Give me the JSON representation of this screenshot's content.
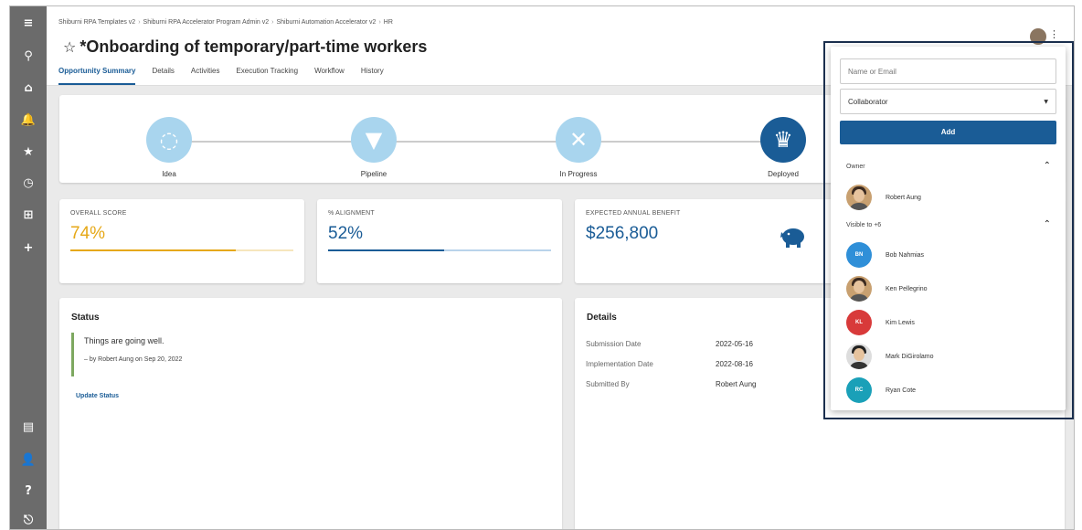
{
  "breadcrumb": [
    "Shiburni RPA Templates v2",
    "Shiburni RPA Accelerator Program Admin v2",
    "Shiburni Automation Accelerator v2",
    "HR"
  ],
  "page": {
    "star": "☆",
    "title": "*Onboarding of temporary/part-time workers"
  },
  "tabs": [
    {
      "label": "Opportunity Summary",
      "active": true
    },
    {
      "label": "Details"
    },
    {
      "label": "Activities"
    },
    {
      "label": "Execution Tracking"
    },
    {
      "label": "Workflow"
    },
    {
      "label": "History"
    }
  ],
  "stages": [
    {
      "label": "Idea",
      "icon": "lightbulb-icon",
      "glyph": "💡"
    },
    {
      "label": "Pipeline",
      "icon": "funnel-icon",
      "glyph": "⏷"
    },
    {
      "label": "In Progress",
      "icon": "tools-icon",
      "glyph": "✖"
    },
    {
      "label": "Deployed",
      "icon": "trophy-icon",
      "glyph": "🏆"
    }
  ],
  "scores": {
    "overall": {
      "label": "OVERALL SCORE",
      "value": "74%",
      "color": "#e6a817"
    },
    "alignment": {
      "label": "% ALIGNMENT",
      "value": "52%",
      "color": "#1a5c96"
    },
    "benefit": {
      "label": "EXPECTED ANNUAL BENEFIT",
      "value": "$256,800",
      "icon": "piggy-bank-icon"
    }
  },
  "status": {
    "heading": "Status",
    "text": "Things are going well.",
    "by": "– by Robert Aung on Sep 20, 2022",
    "link": "Update Status"
  },
  "details": {
    "heading": "Details",
    "rows": [
      {
        "k": "Submission Date",
        "v": "2022-05-16"
      },
      {
        "k": "Implementation Date",
        "v": "2022-08-16"
      },
      {
        "k": "Submitted By",
        "v": "Robert Aung"
      }
    ]
  },
  "share": {
    "placeholder": "Name or Email",
    "role": "Collaborator",
    "add_label": "Add",
    "owner_label": "Owner",
    "owner": "Robert Aung",
    "visible_label": "Visible to +6",
    "users": [
      {
        "name": "Bob Nahmias",
        "initials": "BN",
        "color": "#2f8fd8"
      },
      {
        "name": "Ken Pellegrino",
        "initials": "",
        "photo": true
      },
      {
        "name": "Kim Lewis",
        "initials": "KL",
        "color": "#d83a3a"
      },
      {
        "name": "Mark DiGirolamo",
        "initials": "",
        "photo": true
      },
      {
        "name": "Ryan Cote",
        "initials": "RC",
        "color": "#1aa0b8"
      }
    ]
  },
  "colors": {
    "primary": "#1a5c96",
    "rail": "#6b6b6b",
    "stage_pending": "#a9d5ee",
    "status_bar": "#7da860"
  }
}
